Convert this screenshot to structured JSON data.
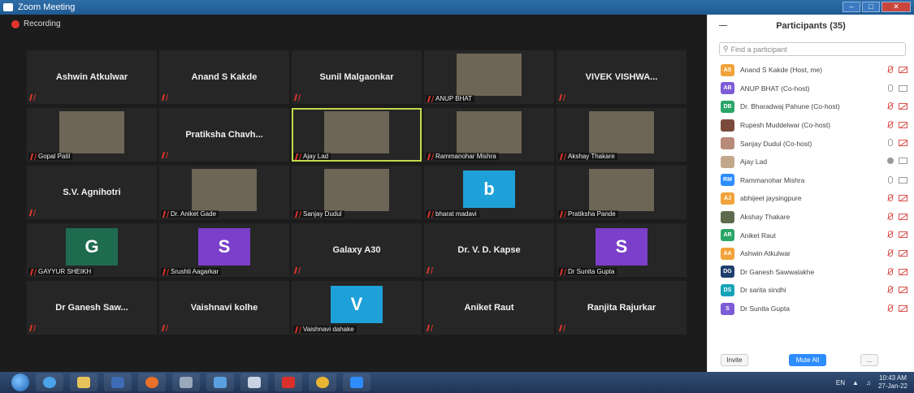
{
  "window": {
    "title": "Zoom Meeting",
    "controls": [
      "–",
      "□",
      "✕"
    ]
  },
  "recording": {
    "label": "Recording"
  },
  "tiles": [
    {
      "name": "Ashwin Atkulwar",
      "caption": ""
    },
    {
      "name": "Anand S Kakde",
      "caption": ""
    },
    {
      "name": "Sunil Malgaonkar",
      "caption": ""
    },
    {
      "name": "",
      "caption": "ANUP BHAT"
    },
    {
      "name": "VIVEK VISHWA...",
      "caption": ""
    },
    {
      "name": "",
      "caption": "Gopal Patil"
    },
    {
      "name": "Pratiksha Chavh...",
      "caption": ""
    },
    {
      "name": "",
      "caption": "Ajay Lad"
    },
    {
      "name": "",
      "caption": "Rammanohar Mishra"
    },
    {
      "name": "",
      "caption": "Akshay Thakare"
    },
    {
      "name": "S.V. Agnihotri",
      "caption": ""
    },
    {
      "name": "",
      "caption": "Dr. Aniket Gade"
    },
    {
      "name": "",
      "caption": "Sanjay Dudul"
    },
    {
      "name": "",
      "caption": "bharat madavi",
      "avatar": "b"
    },
    {
      "name": "",
      "caption": "Pratiksha Pande"
    },
    {
      "name": "",
      "caption": "GAYYUR SHEIKH",
      "avatar": "G"
    },
    {
      "name": "",
      "caption": "Srushti Aagarkar",
      "avatar": "S"
    },
    {
      "name": "Galaxy A30",
      "caption": ""
    },
    {
      "name": "Dr. V. D. Kapse",
      "caption": ""
    },
    {
      "name": "",
      "caption": "Dr Sunita Gupta",
      "avatar": "S"
    },
    {
      "name": "Dr Ganesh Saw...",
      "caption": ""
    },
    {
      "name": "Vaishnavi kolhe",
      "caption": ""
    },
    {
      "name": "",
      "caption": "Vaishnavi dahake",
      "avatar": "V"
    },
    {
      "name": "Aniket Raut",
      "caption": ""
    },
    {
      "name": "Ranjita Rajurkar",
      "caption": ""
    }
  ],
  "panel": {
    "title": "Participants (35)",
    "search_placeholder": "Find a participant",
    "participants": [
      {
        "initials": "AS",
        "name": "Anand S Kakde (Host, me)",
        "color": "#f0a33a",
        "mic": "off",
        "video": "off"
      },
      {
        "initials": "AB",
        "name": "ANUP BHAT (Co-host)",
        "color": "#7b5bd6",
        "mic": "on",
        "video": "on"
      },
      {
        "initials": "DB",
        "name": "Dr. Bharadwaj Pahune (Co-host)",
        "color": "#2aa567",
        "mic": "off",
        "video": "off"
      },
      {
        "initials": "",
        "name": "Rupesh Muddelwar (Co-host)",
        "color": "#7a4b3a",
        "mic": "off",
        "video": "off"
      },
      {
        "initials": "",
        "name": "Sanjay Dudul (Co-host)",
        "color": "#b88a78",
        "mic": "on",
        "video": "off"
      },
      {
        "initials": "",
        "name": "Ajay Lad",
        "color": "#c4a88c",
        "mic": "speaking",
        "video": "on"
      },
      {
        "initials": "RM",
        "name": "Rammanohar Mishra",
        "color": "#2d8cff",
        "mic": "on",
        "video": "on"
      },
      {
        "initials": "AJ",
        "name": "abhijeet jaysingpure",
        "color": "#f0a33a",
        "mic": "off",
        "video": "off"
      },
      {
        "initials": "",
        "name": "Akshay Thakare",
        "color": "#5c6b4d",
        "mic": "off",
        "video": "off"
      },
      {
        "initials": "AR",
        "name": "Aniket Raut",
        "color": "#2aa567",
        "mic": "off",
        "video": "off"
      },
      {
        "initials": "AA",
        "name": "Ashwin Atkulwar",
        "color": "#f0a33a",
        "mic": "off",
        "video": "off"
      },
      {
        "initials": "DG",
        "name": "Dr Ganesh Sawwalakhe",
        "color": "#1e3f6e",
        "mic": "off",
        "video": "off"
      },
      {
        "initials": "DS",
        "name": "Dr sarita sindhi",
        "color": "#16a3b8",
        "mic": "off",
        "video": "off"
      },
      {
        "initials": "S",
        "name": "Dr Sunita Gupta",
        "color": "#7b5bd6",
        "mic": "off",
        "video": "off"
      }
    ],
    "invite_label": "Invite",
    "mute_all_label": "Mute All",
    "more_label": "..."
  },
  "taskbar": {
    "lang": "EN",
    "time": "10:43 AM",
    "date": "27-Jan-22"
  },
  "colors": {
    "active_speaker_border": "#c7d84a",
    "mute_all_bg": "#2d8cff",
    "tile_bg": "#262626"
  }
}
